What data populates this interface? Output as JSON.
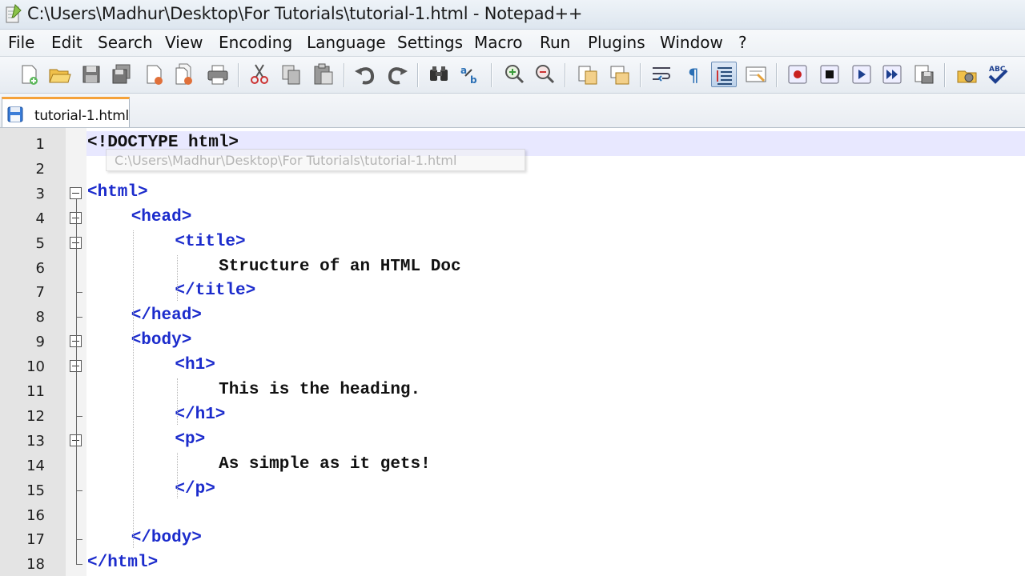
{
  "window": {
    "title": "C:\\Users\\Madhur\\Desktop\\For Tutorials\\tutorial-1.html - Notepad++"
  },
  "menu": [
    "File",
    "Edit",
    "Search",
    "View",
    "Encoding",
    "Language",
    "Settings",
    "Macro",
    "Run",
    "Plugins",
    "Window",
    "?"
  ],
  "toolbar": {
    "buttons": [
      "new-file-icon",
      "open-file-icon",
      "save-icon",
      "save-all-icon",
      "close-icon",
      "close-all-icon",
      "print-icon",
      "cut-icon",
      "copy-icon",
      "paste-icon",
      "undo-icon",
      "redo-icon",
      "find-icon",
      "replace-icon",
      "zoom-in-icon",
      "zoom-out-icon",
      "sync-vertical-icon",
      "sync-horizontal-icon",
      "word-wrap-icon",
      "show-all-characters-icon",
      "indent-guide-icon",
      "user-language-icon",
      "record-macro-icon",
      "stop-recording-icon",
      "play-macro-icon",
      "run-macro-multiple-icon",
      "save-macro-icon",
      "function-list-icon",
      "spell-check-icon"
    ]
  },
  "tabs": [
    {
      "label": "tutorial-1.html",
      "active": true
    }
  ],
  "tooltip": "C:\\Users\\Madhur\\Desktop\\For Tutorials\\tutorial-1.html",
  "editor": {
    "current_line": 1,
    "lines": [
      {
        "n": "1",
        "indent": 0,
        "text": "<!DOCTYPE html>",
        "kind": "doctype"
      },
      {
        "n": "2",
        "indent": 0,
        "text": "",
        "kind": "txt"
      },
      {
        "n": "3",
        "indent": 0,
        "text": "<html>",
        "kind": "tag"
      },
      {
        "n": "4",
        "indent": 1,
        "text": "<head>",
        "kind": "tag"
      },
      {
        "n": "5",
        "indent": 2,
        "text": "<title>",
        "kind": "tag"
      },
      {
        "n": "6",
        "indent": 3,
        "text": "Structure of an HTML Doc",
        "kind": "txt"
      },
      {
        "n": "7",
        "indent": 2,
        "text": "</title>",
        "kind": "tag"
      },
      {
        "n": "8",
        "indent": 1,
        "text": "</head>",
        "kind": "tag"
      },
      {
        "n": "9",
        "indent": 1,
        "text": "<body>",
        "kind": "tag"
      },
      {
        "n": "10",
        "indent": 2,
        "text": "<h1>",
        "kind": "tag"
      },
      {
        "n": "11",
        "indent": 3,
        "text": "This is the heading.",
        "kind": "txt"
      },
      {
        "n": "12",
        "indent": 2,
        "text": "</h1>",
        "kind": "tag"
      },
      {
        "n": "13",
        "indent": 2,
        "text": "<p>",
        "kind": "tag"
      },
      {
        "n": "14",
        "indent": 3,
        "text": "As simple as it gets!",
        "kind": "txt"
      },
      {
        "n": "15",
        "indent": 2,
        "text": "</p>",
        "kind": "tag"
      },
      {
        "n": "16",
        "indent": 0,
        "text": "",
        "kind": "txt"
      },
      {
        "n": "17",
        "indent": 1,
        "text": "</body>",
        "kind": "tag"
      },
      {
        "n": "18",
        "indent": 0,
        "text": "</html>",
        "kind": "tag"
      }
    ]
  },
  "colors": {
    "tag": "#1b2bcc",
    "text": "#111111",
    "current_line": "#e8e8ff",
    "active_tab_accent": "#f5a23a"
  }
}
